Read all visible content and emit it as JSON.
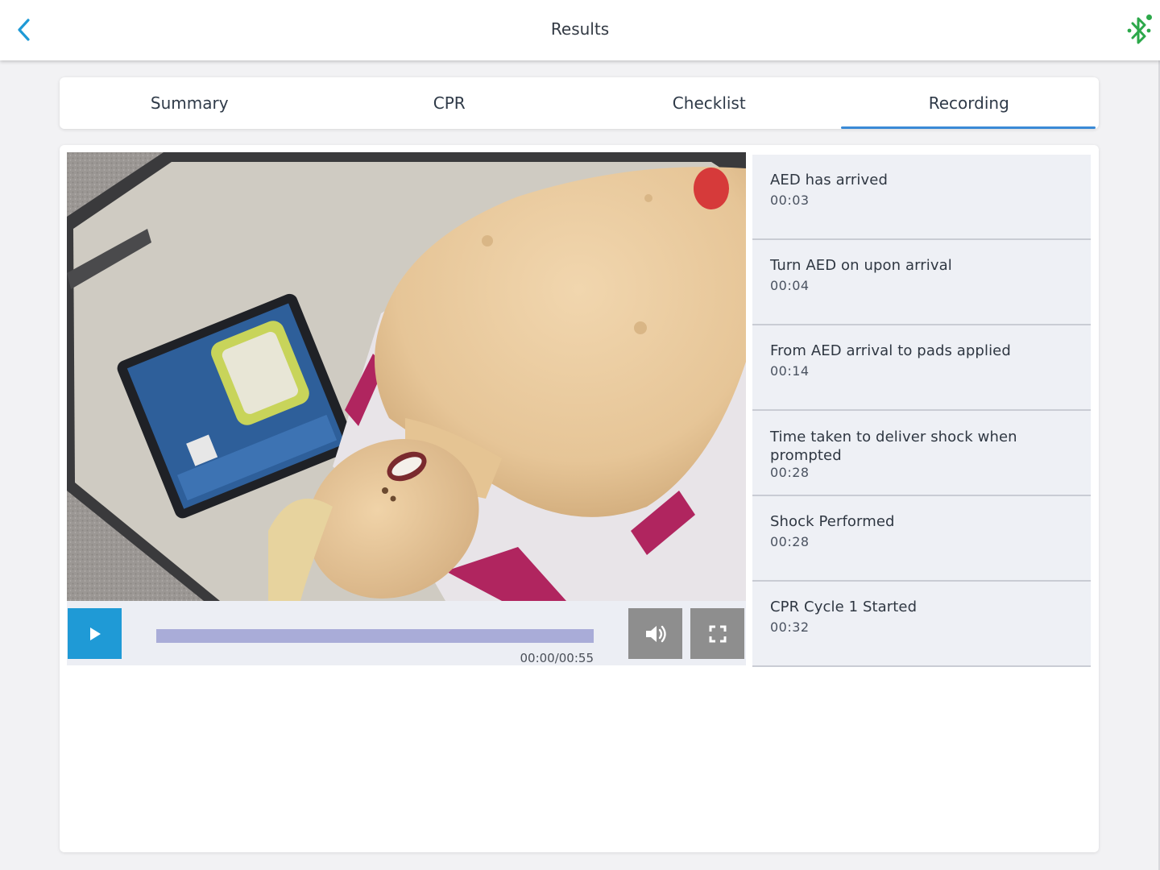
{
  "header": {
    "title": "Results",
    "back_icon": "chevron-left-icon",
    "bluetooth_icon": "bluetooth-icon",
    "accent_color": "#1f9ad6",
    "bluetooth_color": "#2ca84a"
  },
  "tabs": [
    {
      "label": "Summary",
      "active": false
    },
    {
      "label": "CPR",
      "active": false
    },
    {
      "label": "Checklist",
      "active": false
    },
    {
      "label": "Recording",
      "active": true
    }
  ],
  "player": {
    "play_icon": "play-icon",
    "volume_icon": "volume-icon",
    "fullscreen_icon": "fullscreen-icon",
    "time": "00:00/00:55",
    "progress": 0.0
  },
  "events": [
    {
      "title": "AED has arrived",
      "time": "00:03"
    },
    {
      "title": "Turn AED on upon arrival",
      "time": "00:04"
    },
    {
      "title": "From AED arrival to pads applied",
      "time": "00:14"
    },
    {
      "title": "Time taken to deliver shock when prompted",
      "time": "00:28"
    },
    {
      "title": "Shock Performed",
      "time": "00:28"
    },
    {
      "title": "CPR Cycle 1 Started",
      "time": "00:32"
    }
  ]
}
